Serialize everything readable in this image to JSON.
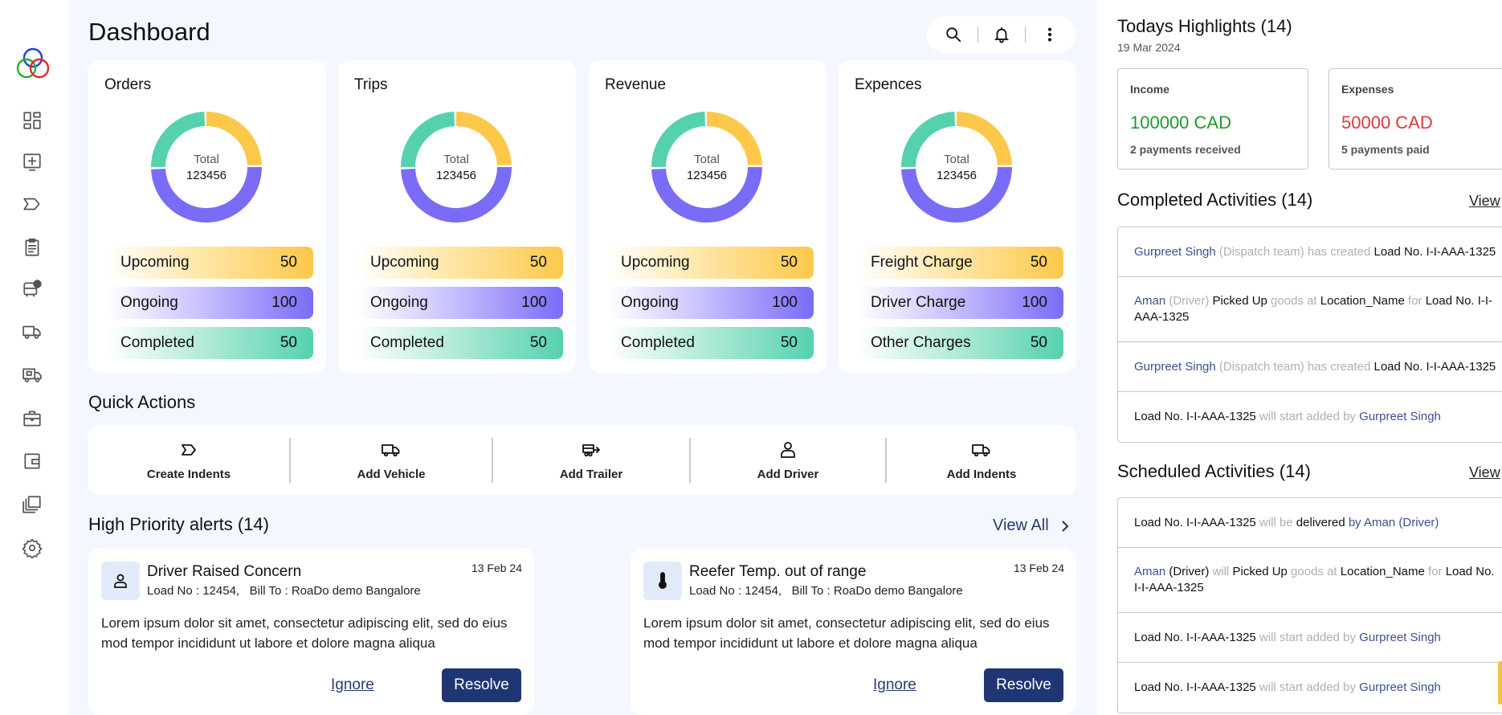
{
  "page": {
    "title": "Dashboard"
  },
  "toolbar": {
    "icons": [
      "search-icon",
      "bell-icon",
      "more-vertical-icon"
    ]
  },
  "sidebar": {
    "items": [
      {
        "name": "dashboard-icon"
      },
      {
        "name": "add-screen-icon"
      },
      {
        "name": "indent-tag-icon"
      },
      {
        "name": "clipboard-icon"
      },
      {
        "name": "bus-schedule-icon"
      },
      {
        "name": "truck-icon"
      },
      {
        "name": "delivery-truck-icon"
      },
      {
        "name": "briefcase-icon"
      },
      {
        "name": "wallet-icon"
      },
      {
        "name": "stack-icon"
      },
      {
        "name": "settings-icon"
      }
    ]
  },
  "stat_cards": [
    {
      "title": "Orders",
      "total_label": "Total",
      "total_value": "123456",
      "rows": [
        {
          "label": "Upcoming",
          "value": "50"
        },
        {
          "label": "Ongoing",
          "value": "100"
        },
        {
          "label": "Completed",
          "value": "50"
        }
      ]
    },
    {
      "title": "Trips",
      "total_label": "Total",
      "total_value": "123456",
      "rows": [
        {
          "label": "Upcoming",
          "value": "50"
        },
        {
          "label": "Ongoing",
          "value": "100"
        },
        {
          "label": "Completed",
          "value": "50"
        }
      ]
    },
    {
      "title": "Revenue",
      "total_label": "Total",
      "total_value": "123456",
      "rows": [
        {
          "label": "Upcoming",
          "value": "50"
        },
        {
          "label": "Ongoing",
          "value": "100"
        },
        {
          "label": "Completed",
          "value": "50"
        }
      ]
    },
    {
      "title": "Expences",
      "total_label": "Total",
      "total_value": "123456",
      "rows": [
        {
          "label": "Freight Charge",
          "value": "50"
        },
        {
          "label": "Driver Charge",
          "value": "100"
        },
        {
          "label": "Other Charges",
          "value": "50"
        }
      ]
    }
  ],
  "colors": {
    "yellow": "#fdc84a",
    "purple": "#7a6cf6",
    "green": "#55d1ae",
    "navy": "#1f3574",
    "income": "#1e9a2c",
    "expense": "#e0363c"
  },
  "quick_actions": {
    "title": "Quick Actions",
    "items": [
      {
        "label": "Create Indents",
        "icon": "indent-tag-icon"
      },
      {
        "label": "Add Vehicle",
        "icon": "truck-icon"
      },
      {
        "label": "Add Trailer",
        "icon": "trailer-icon"
      },
      {
        "label": "Add Driver",
        "icon": "person-icon"
      },
      {
        "label": "Add Indents",
        "icon": "truck-icon"
      }
    ]
  },
  "alerts": {
    "title": "High Priority alerts (14)",
    "view_all": "View All",
    "items": [
      {
        "title": "Driver Raised Concern",
        "subtitle": "Load No : 12454,   Bill To : RoaDo demo Bangalore",
        "date": "13 Feb 24",
        "body": "Lorem ipsum dolor sit amet, consectetur adipiscing elit, sed do eius mod tempor incididunt ut labore et dolore magna aliqua",
        "ignore": "Ignore",
        "resolve": "Resolve",
        "icon": "person-icon"
      },
      {
        "title": "Reefer Temp. out of range",
        "subtitle": "Load No : 12454,   Bill To : RoaDo demo Bangalore",
        "date": "13 Feb 24",
        "body": "Lorem ipsum dolor sit amet, consectetur adipiscing elit, sed do eius mod tempor incididunt ut labore et dolore magna aliqua",
        "ignore": "Ignore",
        "resolve": "Resolve",
        "icon": "thermometer-icon"
      }
    ]
  },
  "highlights": {
    "title": "Todays Highlights (14)",
    "date": "19 Mar 2024",
    "income": {
      "label": "Income",
      "amount": "100000 CAD",
      "note": "2 payments received"
    },
    "expenses": {
      "label": "Expenses",
      "amount": "50000 CAD",
      "note": "5 payments paid"
    }
  },
  "completed": {
    "title": "Completed Activities (14)",
    "view": "View",
    "rows": [
      {
        "parts": [
          [
            "Gurpreet Singh",
            "blue"
          ],
          [
            " (Dispatch team) has created ",
            "grey"
          ],
          [
            "Load No. I-I-AAA-1325",
            "dark"
          ]
        ]
      },
      {
        "parts": [
          [
            "Aman",
            "blue"
          ],
          [
            " (Driver) ",
            "grey"
          ],
          [
            "Picked Up",
            "dark"
          ],
          [
            " goods at ",
            "grey"
          ],
          [
            "Location_Name",
            "dark"
          ],
          [
            " for ",
            "grey"
          ],
          [
            "Load No. I-I-AAA-1325",
            "dark"
          ]
        ]
      },
      {
        "parts": [
          [
            "Gurpreet Singh",
            "blue"
          ],
          [
            " (Dispatch team) has created ",
            "grey"
          ],
          [
            "Load No. I-I-AAA-1325",
            "dark"
          ]
        ]
      },
      {
        "parts": [
          [
            "Load No. I-I-AAA-1325",
            "dark"
          ],
          [
            " will start added by ",
            "grey"
          ],
          [
            "Gurpreet Singh",
            "blue"
          ]
        ]
      }
    ]
  },
  "scheduled": {
    "title": "Scheduled Activities (14)",
    "view": "View",
    "rows": [
      {
        "parts": [
          [
            "Load No. I-I-AAA-1325",
            "dark"
          ],
          [
            " will be ",
            "grey"
          ],
          [
            "delivered",
            "dark"
          ],
          [
            " by Aman (Driver)",
            "blue"
          ]
        ]
      },
      {
        "parts": [
          [
            "Aman",
            "blue"
          ],
          [
            " (Driver) ",
            "dark"
          ],
          [
            "will ",
            "grey"
          ],
          [
            "Picked Up",
            "dark"
          ],
          [
            " goods at ",
            "grey"
          ],
          [
            "Location_Name",
            "dark"
          ],
          [
            " for ",
            "grey"
          ],
          [
            "Load No. I-I-AAA-1325",
            "dark"
          ]
        ]
      },
      {
        "parts": [
          [
            "Load No. I-I-AAA-1325",
            "dark"
          ],
          [
            " will start added by ",
            "grey"
          ],
          [
            "Gurpreet Singh",
            "blue"
          ]
        ]
      },
      {
        "parts": [
          [
            "Load No. I-I-AAA-1325",
            "dark"
          ],
          [
            " will start added by ",
            "grey"
          ],
          [
            "Gurpreet Singh",
            "blue"
          ]
        ]
      }
    ]
  }
}
